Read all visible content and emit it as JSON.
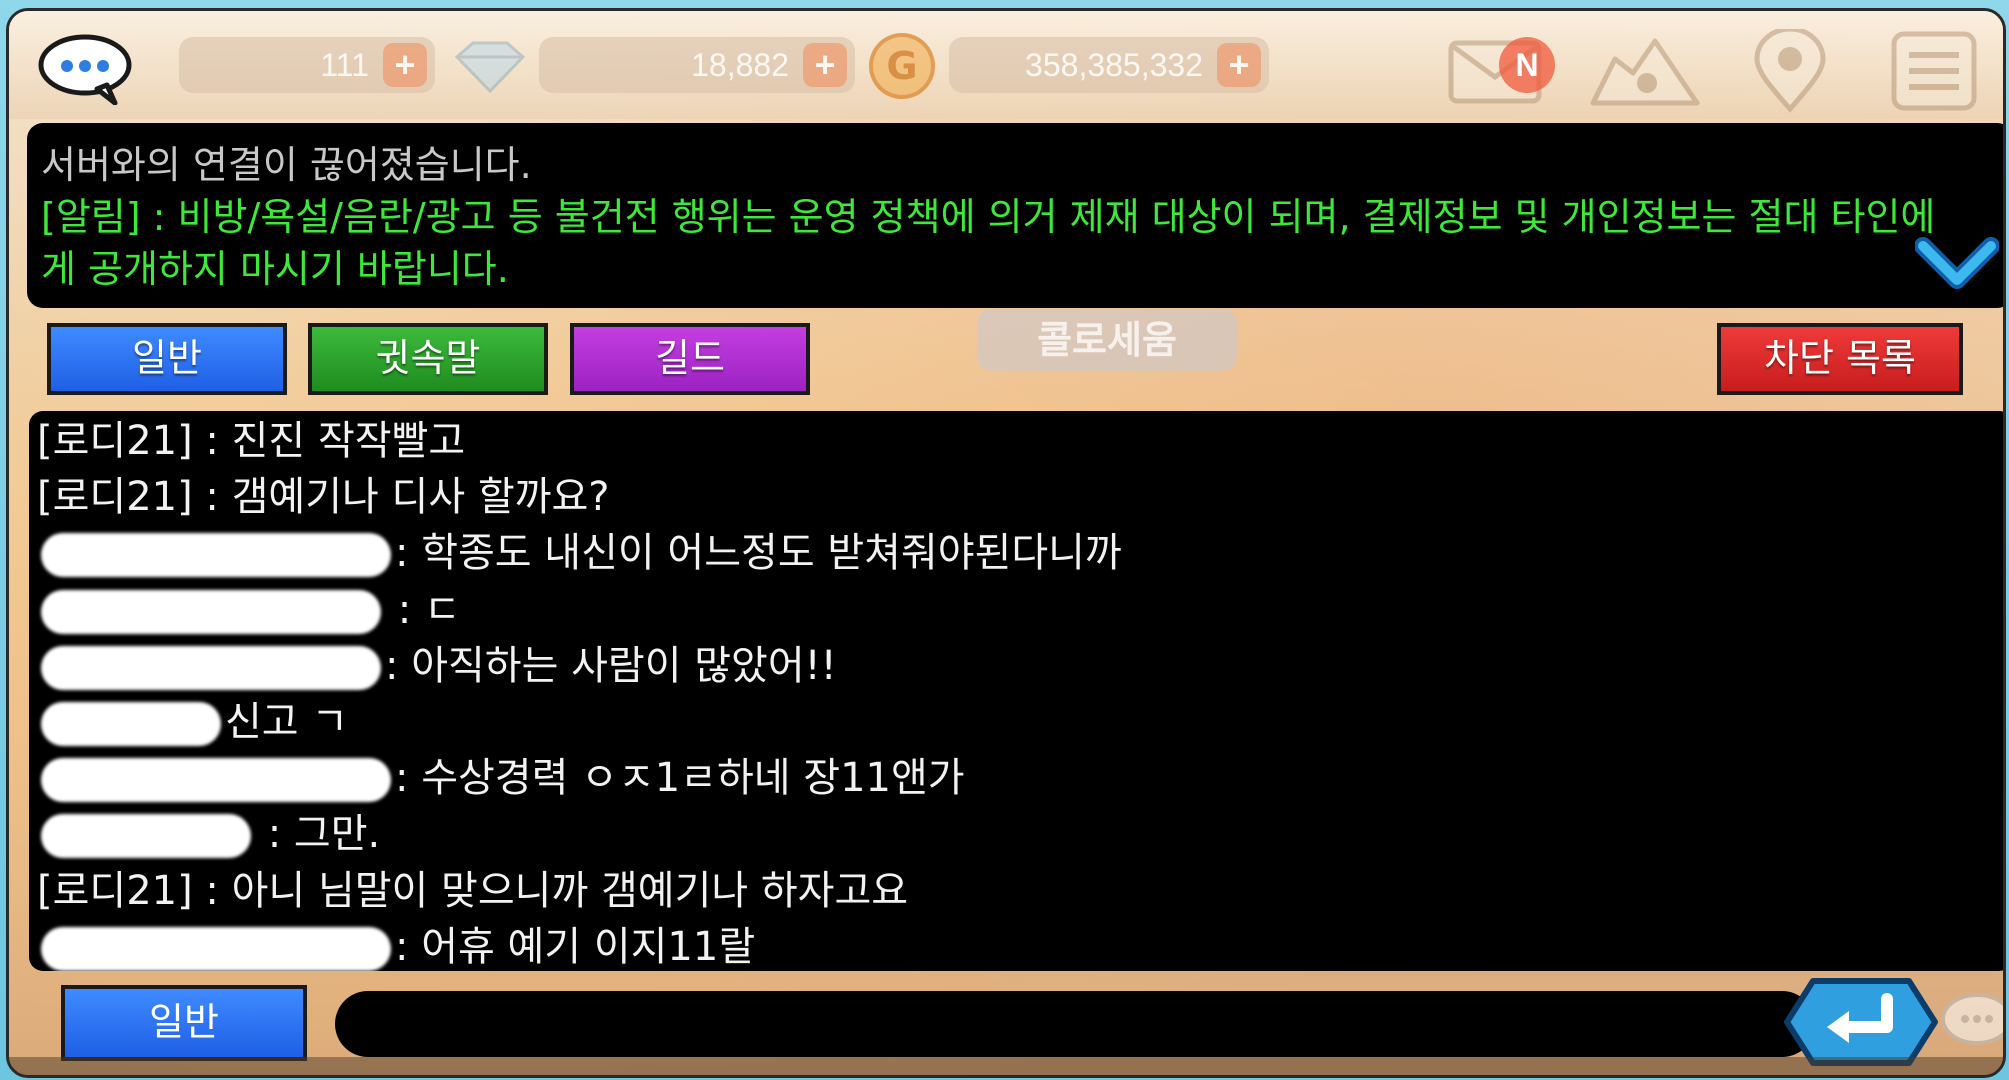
{
  "topbar": {
    "currency_1": "111",
    "currency_2": "18,882",
    "currency_3": "358,385,332",
    "coin_glyph": "G",
    "mail_badge": "N",
    "plus_glyph": "+"
  },
  "notice": {
    "system_line": "서버와의 연결이 끊어졌습니다.",
    "warning_line": "[알림] : 비방/욕설/음란/광고 등 불건전 행위는 운영 정책에 의거 제재 대상이 되며, 결제정보 및 개인정보는 절대 타인에게 공개하지 마시기 바랍니다."
  },
  "tabs": {
    "general": "일반",
    "whisper": "귓속말",
    "guild": "길드",
    "block_list": "차단 목록"
  },
  "location": "콜로세움",
  "chat": {
    "messages": [
      {
        "name": "[로디21]",
        "text": " : 진진 작작빨고"
      },
      {
        "name": "[로디21]",
        "text": " : 갬예기나 디사 할까요?"
      },
      {
        "name": "",
        "text": ": 학종도 내신이 어느정도 받쳐줘야된다니까"
      },
      {
        "name": "",
        "text": " : ㄷ"
      },
      {
        "name": "",
        "text": ": 아직하는 사람이 많았어!!"
      },
      {
        "name": "",
        "text": "신고 ㄱ"
      },
      {
        "name": "",
        "text": ": 수상경력 ㅇㅈ1ㄹ하네 장11앤가"
      },
      {
        "name": "",
        "text": " : 그만."
      },
      {
        "name": "[로디21]",
        "text": " : 아니 님말이 맞으니까 갬예기나 하자고요"
      },
      {
        "name": "",
        "text": ": 어휴 예기 이지11랄"
      }
    ]
  },
  "input": {
    "channel_label": "일반",
    "value": ""
  },
  "colors": {
    "notice_green": "#3ee83a",
    "tab_blue": "#1f5fe6",
    "tab_green": "#1f8c1f",
    "tab_purple": "#9c22c2",
    "tab_red": "#c81d1d"
  },
  "icons": [
    "chat-bubble-icon",
    "gem-icon",
    "coin-icon",
    "mail-icon",
    "home-icon",
    "location-pin-icon",
    "menu-icon",
    "chevron-down-icon",
    "enter-arrow-icon"
  ]
}
